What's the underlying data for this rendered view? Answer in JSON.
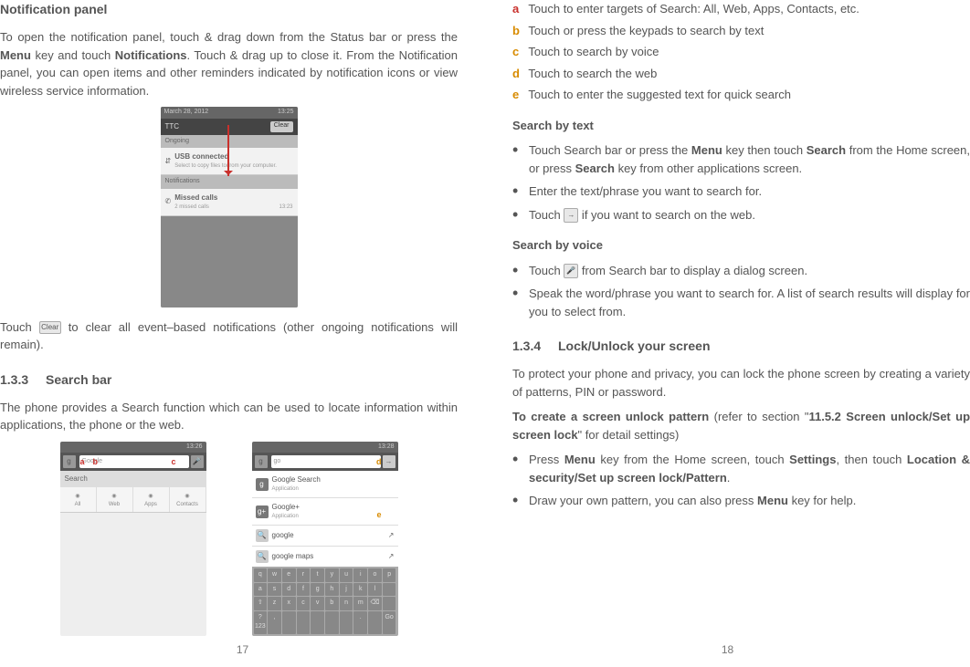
{
  "left": {
    "notif_title": "Notification panel",
    "notif_p1_a": "To open the notification panel, touch & drag down from the Status bar or press the ",
    "notif_p1_b": "Menu",
    "notif_p1_c": " key and touch ",
    "notif_p1_d": "Notifications",
    "notif_p1_e": ". Touch & drag up to close it. From the Notification panel, you can open items and other reminders indicated by notification icons or view wireless service information.",
    "clear_a": "Touch ",
    "clear_btn": "Clear",
    "clear_b": " to clear all event–based notifications (other ongoing notifications will remain).",
    "sec_num": "1.3.3",
    "sec_title": "Search bar",
    "search_p": "The phone provides a Search function which can be used to locate information within applications, the phone or the web.",
    "pagenum": "17",
    "mock_notif": {
      "date": "March 28, 2012",
      "time": "13:25",
      "carrier": "TTC",
      "clear": "Clear",
      "ongoing": "Ongoing",
      "usb_t": "USB connected",
      "usb_s": "Select to copy files to/from your computer.",
      "notifs": "Notifications",
      "missed_t": "Missed calls",
      "missed_s": "2 missed calls",
      "missed_time": "13:23"
    },
    "mock_left": {
      "time": "13:26",
      "input": "Google",
      "tabs": [
        "All",
        "Web",
        "Apps",
        "Contacts"
      ],
      "section": "Search"
    },
    "mock_right": {
      "time": "13:28",
      "input": "go",
      "r1_t": "Google Search",
      "r1_s": "Application",
      "r2_t": "Google+",
      "r2_s": "Application",
      "r3_t": "google",
      "r4_t": "google maps",
      "kb": [
        "q",
        "w",
        "e",
        "r",
        "t",
        "y",
        "u",
        "i",
        "o",
        "p",
        "a",
        "s",
        "d",
        "f",
        "g",
        "h",
        "j",
        "k",
        "l",
        "",
        "⇧",
        "z",
        "x",
        "c",
        "v",
        "b",
        "n",
        "m",
        "⌫",
        "",
        "?123",
        ",",
        "",
        "",
        "",
        "",
        "",
        ".",
        "",
        "Go"
      ]
    },
    "callouts": {
      "a": "a",
      "b": "b",
      "c": "c",
      "d": "d",
      "e": "e"
    }
  },
  "right": {
    "legend": [
      {
        "k": "a",
        "cls": "la",
        "t": "Touch to enter targets of Search: All, Web, Apps, Contacts, etc."
      },
      {
        "k": "b",
        "cls": "lb",
        "t": "Touch or press the keypads to search by text"
      },
      {
        "k": "c",
        "cls": "lc",
        "t": "Touch to search by voice"
      },
      {
        "k": "d",
        "cls": "ld",
        "t": "Touch to search the web"
      },
      {
        "k": "e",
        "cls": "le",
        "t": "Touch to enter the suggested text for quick search"
      }
    ],
    "sbt_title": "Search by text",
    "sbt": [
      {
        "a": "Touch Search bar or press the ",
        "b": "Menu",
        "c": " key then touch ",
        "d": "Search",
        "e": " from the Home screen, or press ",
        "f": "Search",
        "g": " key from other applications screen."
      },
      {
        "a": "Enter the text/phrase you want to search for."
      },
      {
        "a": "Touch ",
        "icon": "→",
        "b": " if you want to search on the web."
      }
    ],
    "sbv_title": "Search by voice",
    "sbv": [
      {
        "a": "Touch ",
        "icon": "🎤",
        "b": " from Search bar to display a dialog screen."
      },
      {
        "a": "Speak the word/phrase you want to search for.  A list of search results will display for you to select from."
      }
    ],
    "sec_num": "1.3.4",
    "sec_title": "Lock/Unlock your screen",
    "lock_p": "To protect your phone and privacy, you can lock the phone screen by creating a variety of patterns, PIN or password.",
    "create_a": "To create a screen unlock pattern",
    "create_b": " (refer to section \"",
    "create_c": "11.5.2 Screen unlock/Set up screen lock",
    "create_d": "\" for detail settings)",
    "steps": [
      {
        "a": "Press ",
        "b": "Menu",
        "c": " key from the Home screen, touch ",
        "d": "Settings",
        "e": ", then touch ",
        "f": "Location & security/Set up screen lock/Pattern",
        "g": "."
      },
      {
        "a": "Draw your own pattern, you can also press ",
        "b": "Menu",
        "c": " key for help."
      }
    ],
    "pagenum": "18"
  }
}
